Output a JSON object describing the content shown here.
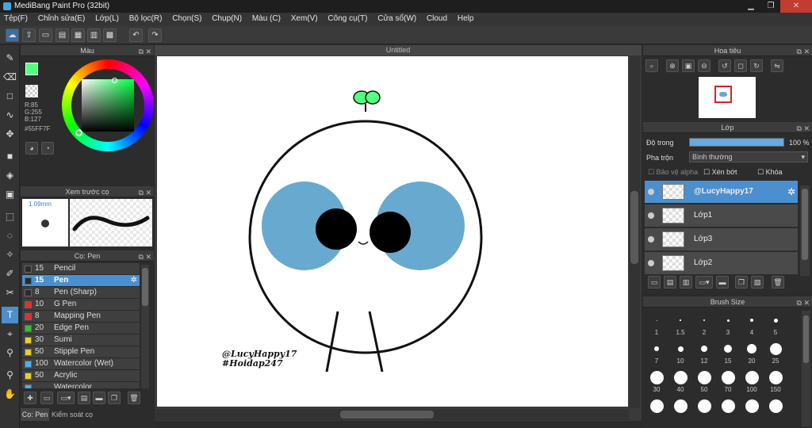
{
  "app": {
    "title": "MediBang Paint Pro (32bit)"
  },
  "window_controls": {
    "minimize": "▁",
    "restore": "❐",
    "close": "✕"
  },
  "menu": [
    "Tệp(F)",
    "Chỉnh sửa(E)",
    "Lớp(L)",
    "Bộ lọc(R)",
    "Chọn(S)",
    "Chụp(N)",
    "Màu (C)",
    "Xem(V)",
    "Công cụ(T)",
    "Cửa sổ(W)",
    "Cloud",
    "Help"
  ],
  "color_panel": {
    "title": "Màu",
    "r": "R:85",
    "g": "G:255",
    "b": "B:127",
    "hex": "#55FF7F",
    "current_color": "#55ff7f"
  },
  "brush_preview": {
    "title": "Xem trước cọ",
    "size": "1.09mm"
  },
  "brush_list": {
    "title": "Cọ: Pen",
    "items": [
      {
        "size": "15",
        "name": "Pencil",
        "color": "#2a2a2a"
      },
      {
        "size": "15",
        "name": "Pen",
        "color": "#2a2a2a"
      },
      {
        "size": "8",
        "name": "Pen (Sharp)",
        "color": "#2a2a2a"
      },
      {
        "size": "10",
        "name": "G Pen",
        "color": "#e03030"
      },
      {
        "size": "8",
        "name": "Mapping Pen",
        "color": "#e03030"
      },
      {
        "size": "20",
        "name": "Edge Pen",
        "color": "#30c030"
      },
      {
        "size": "30",
        "name": "Sumi",
        "color": "#e8d020"
      },
      {
        "size": "50",
        "name": "Stipple Pen",
        "color": "#e8d020"
      },
      {
        "size": "100",
        "name": "Watercolor (Wet)",
        "color": "#4ab0e8"
      },
      {
        "size": "50",
        "name": "Acrylic",
        "color": "#e8d020"
      },
      {
        "size": "",
        "name": "Watercolor",
        "color": "#4ab0e8"
      }
    ],
    "tab_brush": "Cọ: Pen",
    "tab_control": "Kiểm soát cọ"
  },
  "canvas": {
    "doc_title": "Untitled",
    "signature_line1": "@LucyHappy17",
    "signature_line2": "#Hoidap247"
  },
  "navigator": {
    "title": "Hoa tiêu"
  },
  "layers": {
    "title": "Lớp",
    "opacity_label": "Độ trong",
    "opacity_value": "100 %",
    "opacity_fraction": 1.0,
    "blend_label": "Pha trộn",
    "blend_value": "Bình thường",
    "protect_alpha": "Bảo vệ alpha",
    "clipping": "Xén bớt",
    "lock": "Khóa",
    "items": [
      {
        "name": "@LucyHappy17",
        "selected": true
      },
      {
        "name": "Lớp1",
        "selected": false
      },
      {
        "name": "Lớp3",
        "selected": false
      },
      {
        "name": "Lớp2",
        "selected": false
      }
    ]
  },
  "brush_size": {
    "title": "Brush Size",
    "sizes": [
      "1",
      "1.5",
      "2",
      "3",
      "4",
      "5",
      "7",
      "10",
      "12",
      "15",
      "20",
      "25",
      "30",
      "40",
      "50",
      "70",
      "100",
      "150",
      "",
      "",
      "",
      "",
      "",
      ""
    ]
  },
  "colors": {
    "accent": "#4b8fcf",
    "face_blue": "#67a9cf",
    "sprout": "#55ff7f"
  }
}
